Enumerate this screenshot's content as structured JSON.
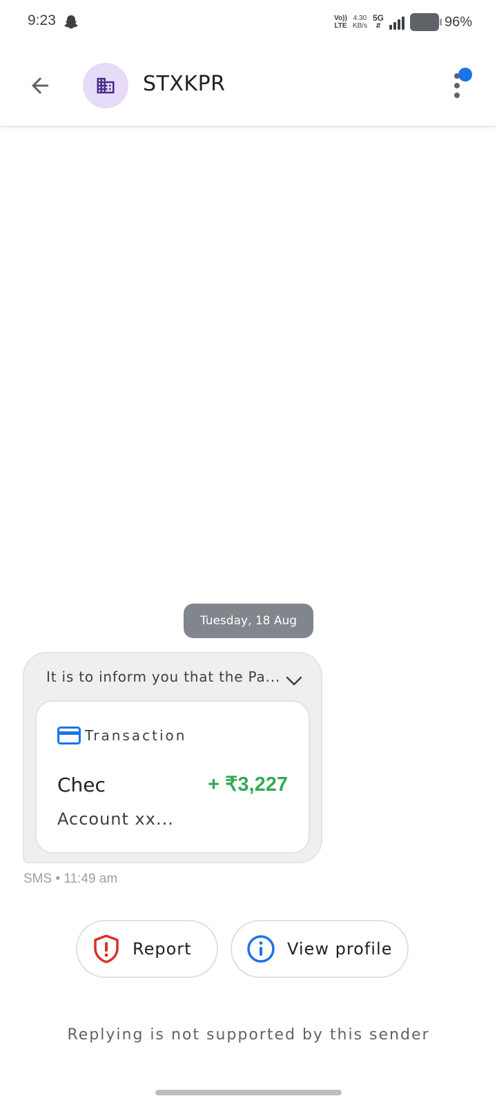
{
  "status_bar": {
    "time": "9:23",
    "volte_top": "Vo))",
    "volte_bottom": "LTE",
    "speed_value": "4.30",
    "speed_unit": "KB/s",
    "network": "5G",
    "battery": "96%"
  },
  "header": {
    "sender": "STXKPR",
    "avatar_icon": "business-icon",
    "avatar_bg": "#e6dcf7",
    "avatar_fg": "#4a2b8f",
    "notification_dot_color": "#1a73e8"
  },
  "conversation": {
    "date_chip": "Tuesday, 18 Aug",
    "message": {
      "preview": "It is to inform you that the Pa...",
      "card": {
        "type_label": "Transaction",
        "name": "Chec",
        "amount": "+ ₹3,227",
        "account": "Account xx...",
        "amount_color": "#34a853"
      },
      "meta": "SMS • 11:49 am"
    }
  },
  "actions": {
    "report_label": "Report",
    "view_profile_label": "View profile"
  },
  "footer": {
    "reply_note": "Replying is not supported by this sender"
  }
}
